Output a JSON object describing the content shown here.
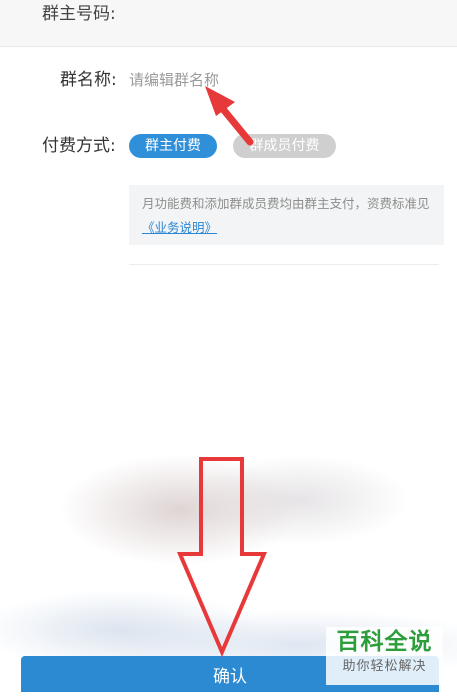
{
  "form": {
    "owner_number_label": "群主号码",
    "owner_number_colon": ":",
    "group_name_label": "群名称:",
    "group_name_placeholder": "请编辑群名称",
    "group_name_value": "",
    "payment_label": "付费方式:",
    "payment_options": [
      {
        "label": "群主付费",
        "selected": true
      },
      {
        "label": "群成员付费",
        "selected": false
      }
    ],
    "note_text": "月功能费和添加群成员费均由群主支付，资费标准见",
    "note_link": "《业务说明》"
  },
  "footer": {
    "confirm_label": "确认"
  },
  "watermark": {
    "title": "百科全说",
    "subtitle": "助你轻松解决"
  },
  "colors": {
    "accent": "#2f8fd8",
    "unselected_pill": "#cfcfcf",
    "annotation_red": "#e8393a",
    "watermark_green": "#2e9e3c"
  }
}
